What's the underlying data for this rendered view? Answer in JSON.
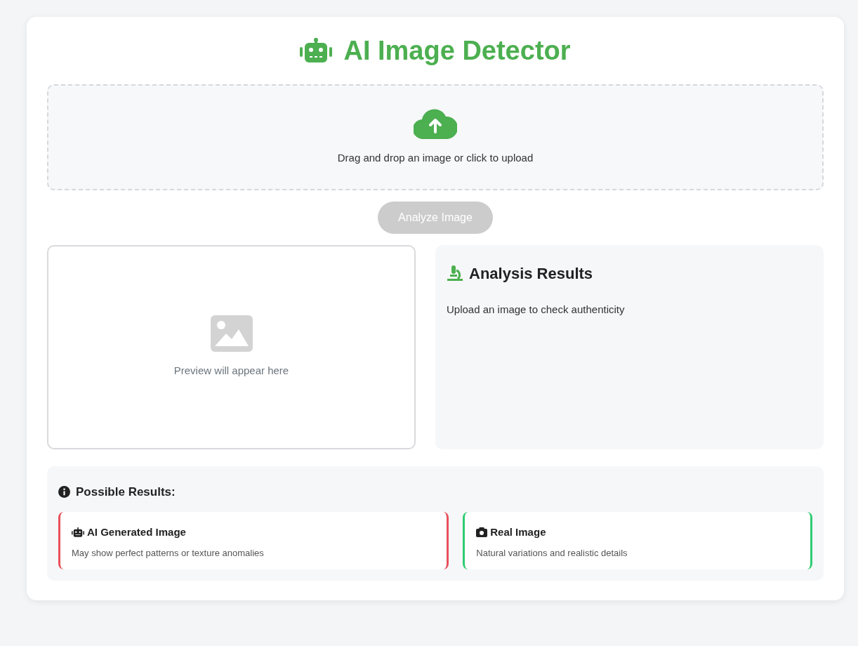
{
  "header": {
    "title": "AI Image Detector"
  },
  "upload": {
    "prompt": "Drag and drop an image or click to upload"
  },
  "analyze_button": {
    "label": "Analyze Image",
    "disabled": true
  },
  "preview": {
    "message": "Preview will appear here"
  },
  "results": {
    "title": "Analysis Results",
    "message": "Upload an image to check authenticity"
  },
  "possible_results": {
    "title": "Possible Results:",
    "options": [
      {
        "kind": "ai",
        "title": "AI Generated Image",
        "description": "May show perfect patterns or texture anomalies",
        "color": "#e8505b"
      },
      {
        "kind": "real",
        "title": "Real Image",
        "description": "Natural variations and realistic details",
        "color": "#2ecc71"
      }
    ]
  }
}
